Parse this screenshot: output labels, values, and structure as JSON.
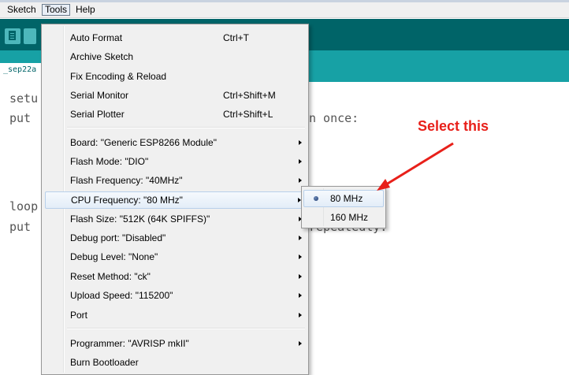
{
  "menubar": {
    "items": [
      "Sketch",
      "Tools",
      "Help"
    ]
  },
  "tab": {
    "label": "_sep22a"
  },
  "editor": {
    "lines": [
      "setu",
      "put",
      "n once:",
      "loop",
      "put",
      "repeatedly:"
    ]
  },
  "tools_menu": {
    "items": [
      {
        "label": "Auto Format",
        "shortcut": "Ctrl+T"
      },
      {
        "label": "Archive Sketch",
        "shortcut": ""
      },
      {
        "label": "Fix Encoding & Reload",
        "shortcut": ""
      },
      {
        "label": "Serial Monitor",
        "shortcut": "Ctrl+Shift+M"
      },
      {
        "label": "Serial Plotter",
        "shortcut": "Ctrl+Shift+L"
      },
      {
        "label": "Board: \"Generic ESP8266 Module\"",
        "shortcut": ""
      },
      {
        "label": "Flash Mode: \"DIO\"",
        "shortcut": ""
      },
      {
        "label": "Flash Frequency: \"40MHz\"",
        "shortcut": ""
      },
      {
        "label": "CPU Frequency: \"80 MHz\"",
        "shortcut": ""
      },
      {
        "label": "Flash Size: \"512K (64K SPIFFS)\"",
        "shortcut": ""
      },
      {
        "label": "Debug port: \"Disabled\"",
        "shortcut": ""
      },
      {
        "label": "Debug Level: \"None\"",
        "shortcut": ""
      },
      {
        "label": "Reset Method: \"ck\"",
        "shortcut": ""
      },
      {
        "label": "Upload Speed: \"115200\"",
        "shortcut": ""
      },
      {
        "label": "Port",
        "shortcut": ""
      },
      {
        "label": "Programmer: \"AVRISP mkII\"",
        "shortcut": ""
      },
      {
        "label": "Burn Bootloader",
        "shortcut": ""
      }
    ],
    "highlighted_item": "CPU Frequency: \"80 MHz\""
  },
  "cpu_submenu": {
    "options": [
      "80 MHz",
      "160 MHz"
    ],
    "selected": "80 MHz"
  },
  "annotation": {
    "text": "Select this",
    "color": "#e8201a"
  },
  "colors": {
    "toolbar": "#006468",
    "tabbar": "#17a1a5",
    "menu_bg": "#f0f0f0",
    "highlight_border": "#b8d0ea"
  }
}
